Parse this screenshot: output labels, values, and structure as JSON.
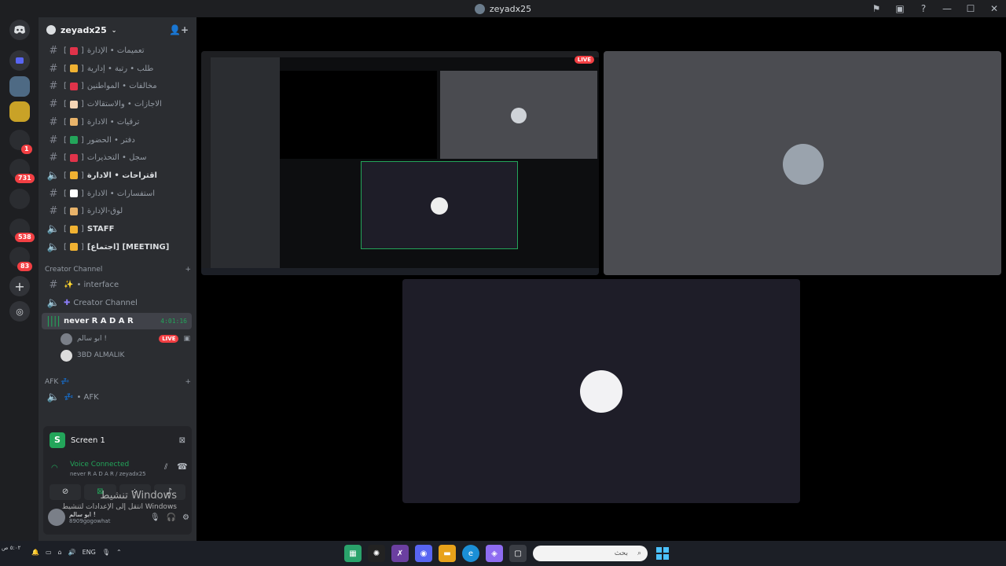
{
  "titlebar": {
    "title": "zeyadx25"
  },
  "server": {
    "name": "zeyadx25"
  },
  "channels": [
    {
      "name": "تعميمات • الإدارة",
      "type": "text",
      "emoji_color": "#e0334a"
    },
    {
      "name": "طلب • رتبة • إدارية",
      "type": "text",
      "emoji_color": "#f0b232"
    },
    {
      "name": "مخالفات • المواطنين",
      "type": "text",
      "emoji_color": "#e0334a"
    },
    {
      "name": "الاجازات • والاستقالات",
      "type": "text",
      "emoji_color": "#f5d5b5"
    },
    {
      "name": "ترقيات • الادارة",
      "type": "text",
      "emoji_color": "#e8b36a"
    },
    {
      "name": "دفتر • الحضور",
      "type": "text",
      "emoji_color": "#23a55a"
    },
    {
      "name": "سجل • التحذيرات",
      "type": "text",
      "emoji_color": "#e0334a"
    },
    {
      "name": "اقتراحات • الادارة",
      "type": "voice",
      "emoji_color": "#f0b232"
    },
    {
      "name": "استفسارات • الادارة",
      "type": "text",
      "emoji_color": "#ffffff"
    },
    {
      "name": "لوق-الإدارة",
      "type": "text",
      "emoji_color": "#e8b36a"
    },
    {
      "name": "STAFF",
      "type": "voice",
      "emoji_color": "#f0b232"
    },
    {
      "name": "[MEETING] [اجتماع]",
      "type": "voice",
      "emoji_color": "#f0b232"
    }
  ],
  "category_creator": "Creator Channel",
  "creator_channels": [
    {
      "name": "• interface",
      "type": "text"
    },
    {
      "name": "Creator Channel",
      "type": "voice"
    }
  ],
  "active_vc": {
    "name": "never R A D A R",
    "timer": "4:01:16"
  },
  "vc_users": [
    {
      "name": "ابو سالم !",
      "live": "LIVE"
    },
    {
      "name": "3BD ALMALIK",
      "live": ""
    }
  ],
  "category_afk": "AFK",
  "afk_channel": {
    "name": "• AFK"
  },
  "screen_panel": {
    "title": "Screen 1",
    "status": "Voice Connected",
    "sub": "never R A D A R / zeyadx25"
  },
  "user": {
    "name": "ابو سالم !",
    "tag": "8909gogowhat"
  },
  "guild_badges": [
    "1",
    "731",
    "538",
    "83"
  ],
  "watermark": {
    "line1": "تنشيط Windows",
    "line2": "انتقل إلى الإعدادات لتنشيط Windows"
  },
  "stream": {
    "live_label": "LIVE"
  },
  "taskbar": {
    "lang": "ENG",
    "search_placeholder": "بحث",
    "time": "٥:٠٢ ص"
  },
  "colors": {
    "accent": "#23a55a",
    "live": "#f23f43",
    "bg": "#000000"
  }
}
